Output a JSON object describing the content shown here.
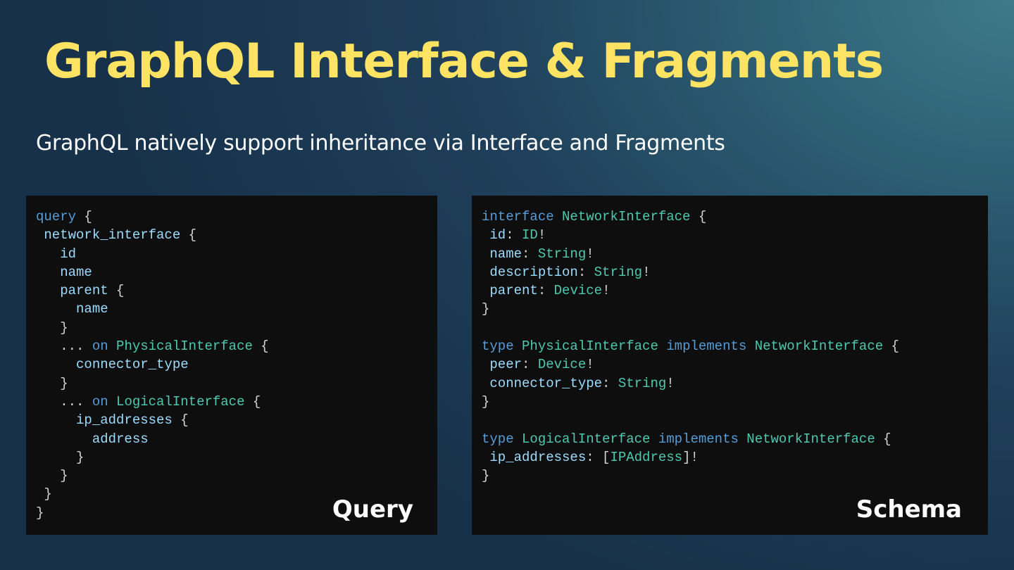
{
  "slide": {
    "title": "GraphQL Interface & Fragments",
    "subtitle": "GraphQL natively support inheritance via Interface and Fragments"
  },
  "query_panel": {
    "label": "Query",
    "lines": [
      [
        {
          "t": "query",
          "c": "kw"
        },
        {
          "t": " {",
          "c": "punct"
        }
      ],
      [
        {
          "t": " ",
          "c": "punct"
        },
        {
          "t": "network_interface",
          "c": "field"
        },
        {
          "t": " {",
          "c": "punct"
        }
      ],
      [
        {
          "t": "   ",
          "c": "punct"
        },
        {
          "t": "id",
          "c": "field"
        }
      ],
      [
        {
          "t": "   ",
          "c": "punct"
        },
        {
          "t": "name",
          "c": "field"
        }
      ],
      [
        {
          "t": "   ",
          "c": "punct"
        },
        {
          "t": "parent",
          "c": "field"
        },
        {
          "t": " {",
          "c": "punct"
        }
      ],
      [
        {
          "t": "     ",
          "c": "punct"
        },
        {
          "t": "name",
          "c": "field"
        }
      ],
      [
        {
          "t": "   }",
          "c": "punct"
        }
      ],
      [
        {
          "t": "   ... ",
          "c": "punct"
        },
        {
          "t": "on",
          "c": "kw"
        },
        {
          "t": " ",
          "c": "punct"
        },
        {
          "t": "PhysicalInterface",
          "c": "type"
        },
        {
          "t": " {",
          "c": "punct"
        }
      ],
      [
        {
          "t": "     ",
          "c": "punct"
        },
        {
          "t": "connector_type",
          "c": "field"
        }
      ],
      [
        {
          "t": "   }",
          "c": "punct"
        }
      ],
      [
        {
          "t": "   ... ",
          "c": "punct"
        },
        {
          "t": "on",
          "c": "kw"
        },
        {
          "t": " ",
          "c": "punct"
        },
        {
          "t": "LogicalInterface",
          "c": "type"
        },
        {
          "t": " {",
          "c": "punct"
        }
      ],
      [
        {
          "t": "     ",
          "c": "punct"
        },
        {
          "t": "ip_addresses",
          "c": "field"
        },
        {
          "t": " {",
          "c": "punct"
        }
      ],
      [
        {
          "t": "       ",
          "c": "punct"
        },
        {
          "t": "address",
          "c": "field"
        }
      ],
      [
        {
          "t": "     }",
          "c": "punct"
        }
      ],
      [
        {
          "t": "   }",
          "c": "punct"
        }
      ],
      [
        {
          "t": " }",
          "c": "punct"
        }
      ],
      [
        {
          "t": "}",
          "c": "punct"
        }
      ]
    ]
  },
  "schema_panel": {
    "label": "Schema",
    "lines": [
      [
        {
          "t": "interface",
          "c": "kw"
        },
        {
          "t": " ",
          "c": "punct"
        },
        {
          "t": "NetworkInterface",
          "c": "type"
        },
        {
          "t": " {",
          "c": "punct"
        }
      ],
      [
        {
          "t": " ",
          "c": "punct"
        },
        {
          "t": "id",
          "c": "field"
        },
        {
          "t": ": ",
          "c": "punct"
        },
        {
          "t": "ID",
          "c": "type"
        },
        {
          "t": "!",
          "c": "punct"
        }
      ],
      [
        {
          "t": " ",
          "c": "punct"
        },
        {
          "t": "name",
          "c": "field"
        },
        {
          "t": ": ",
          "c": "punct"
        },
        {
          "t": "String",
          "c": "type"
        },
        {
          "t": "!",
          "c": "punct"
        }
      ],
      [
        {
          "t": " ",
          "c": "punct"
        },
        {
          "t": "description",
          "c": "field"
        },
        {
          "t": ": ",
          "c": "punct"
        },
        {
          "t": "String",
          "c": "type"
        },
        {
          "t": "!",
          "c": "punct"
        }
      ],
      [
        {
          "t": " ",
          "c": "punct"
        },
        {
          "t": "parent",
          "c": "field"
        },
        {
          "t": ": ",
          "c": "punct"
        },
        {
          "t": "Device",
          "c": "type"
        },
        {
          "t": "!",
          "c": "punct"
        }
      ],
      [
        {
          "t": "}",
          "c": "punct"
        }
      ],
      [],
      [
        {
          "t": "type",
          "c": "kw"
        },
        {
          "t": " ",
          "c": "punct"
        },
        {
          "t": "PhysicalInterface",
          "c": "type"
        },
        {
          "t": " ",
          "c": "punct"
        },
        {
          "t": "implements",
          "c": "kw"
        },
        {
          "t": " ",
          "c": "punct"
        },
        {
          "t": "NetworkInterface",
          "c": "type"
        },
        {
          "t": " {",
          "c": "punct"
        }
      ],
      [
        {
          "t": " ",
          "c": "punct"
        },
        {
          "t": "peer",
          "c": "field"
        },
        {
          "t": ": ",
          "c": "punct"
        },
        {
          "t": "Device",
          "c": "type"
        },
        {
          "t": "!",
          "c": "punct"
        }
      ],
      [
        {
          "t": " ",
          "c": "punct"
        },
        {
          "t": "connector_type",
          "c": "field"
        },
        {
          "t": ": ",
          "c": "punct"
        },
        {
          "t": "String",
          "c": "type"
        },
        {
          "t": "!",
          "c": "punct"
        }
      ],
      [
        {
          "t": "}",
          "c": "punct"
        }
      ],
      [],
      [
        {
          "t": "type",
          "c": "kw"
        },
        {
          "t": " ",
          "c": "punct"
        },
        {
          "t": "LogicalInterface",
          "c": "type"
        },
        {
          "t": " ",
          "c": "punct"
        },
        {
          "t": "implements",
          "c": "kw"
        },
        {
          "t": " ",
          "c": "punct"
        },
        {
          "t": "NetworkInterface",
          "c": "type"
        },
        {
          "t": " {",
          "c": "punct"
        }
      ],
      [
        {
          "t": " ",
          "c": "punct"
        },
        {
          "t": "ip_addresses",
          "c": "field"
        },
        {
          "t": ": [",
          "c": "punct"
        },
        {
          "t": "IPAddress",
          "c": "type"
        },
        {
          "t": "]!",
          "c": "punct"
        }
      ],
      [
        {
          "t": "}",
          "c": "punct"
        }
      ]
    ]
  },
  "colors": {
    "title": "#ffe363",
    "keyword": "#569cd6",
    "field": "#9cdcfe",
    "type": "#4ec9b0",
    "punctuation": "#d4d4d4",
    "panel_background": "#0e0e0e"
  }
}
